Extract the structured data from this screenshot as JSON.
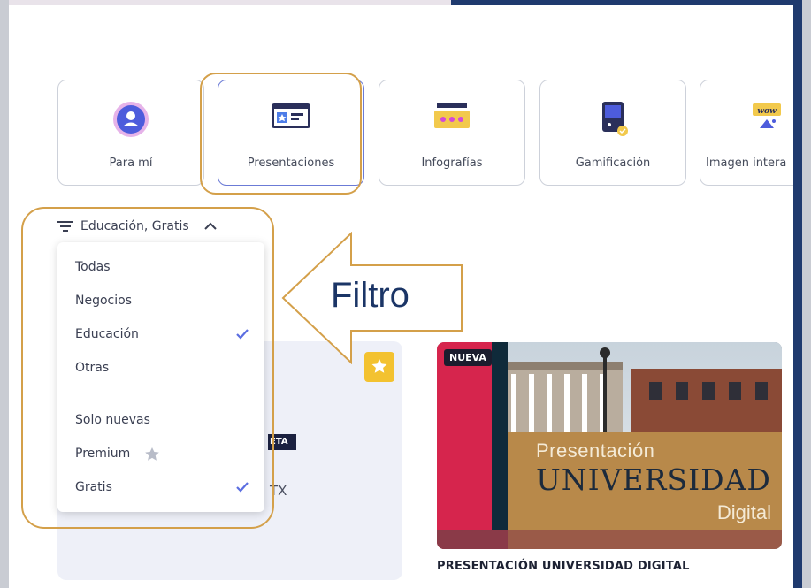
{
  "categories": [
    {
      "label": "Para mí",
      "icon": "user-avatar-icon"
    },
    {
      "label": "Presentaciones",
      "icon": "presentation-icon"
    },
    {
      "label": "Infografías",
      "icon": "infographic-icon"
    },
    {
      "label": "Gamificación",
      "icon": "game-console-icon"
    },
    {
      "label": "Imagen intera",
      "icon": "wow-image-icon"
    }
  ],
  "filter": {
    "summary": "Educación, Gratis",
    "options_type": [
      {
        "label": "Todas",
        "checked": false
      },
      {
        "label": "Negocios",
        "checked": false
      },
      {
        "label": "Educación",
        "checked": true
      },
      {
        "label": "Otras",
        "checked": false
      }
    ],
    "options_flags": [
      {
        "label": "Solo nuevas",
        "checked": false
      },
      {
        "label": "Premium",
        "checked": false
      },
      {
        "label": "Gratis",
        "checked": true
      }
    ]
  },
  "callout": {
    "text": "Filtro"
  },
  "cards": [
    {
      "tag": "ETA",
      "text_fragment": "TX"
    },
    {
      "badge": "NUEVA",
      "thumb_line1": "Presentación",
      "thumb_line2": "UNIVERSIDAD",
      "thumb_line3": "Digital",
      "title": "PRESENTACIÓN UNIVERSIDAD DIGITAL"
    }
  ],
  "colors": {
    "accent": "#5b6ee1",
    "highlight": "#d4a04a",
    "callout_text": "#1b3566",
    "nueva_badge": "#d6254d",
    "gold_panel": "#b8894a",
    "dark_panel": "#0f2a3a"
  }
}
